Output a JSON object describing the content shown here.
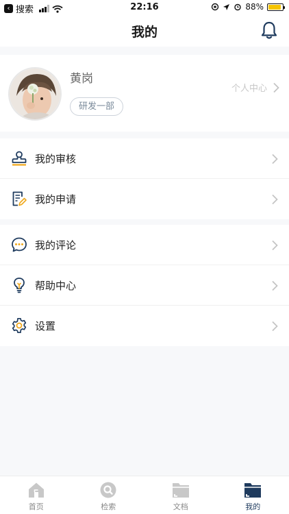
{
  "status_bar": {
    "back_label": "搜索",
    "time": "22:16",
    "battery": "88%",
    "battery_level": 0.88
  },
  "nav": {
    "title": "我的",
    "right_icon": "bell-icon"
  },
  "profile": {
    "name": "黄岗",
    "department": "研发一部",
    "center_link": "个人中心"
  },
  "menu_groups": [
    {
      "items": [
        {
          "label": "我的审核",
          "icon": "stamp-icon"
        },
        {
          "label": "我的申请",
          "icon": "edit-document-icon"
        }
      ]
    },
    {
      "items": [
        {
          "label": "我的评论",
          "icon": "comment-icon"
        },
        {
          "label": "帮助中心",
          "icon": "lightbulb-icon"
        },
        {
          "label": "设置",
          "icon": "gear-icon"
        }
      ]
    }
  ],
  "tabbar": {
    "tabs": [
      {
        "label": "首页",
        "icon": "home-icon",
        "active": false
      },
      {
        "label": "检索",
        "icon": "search-icon",
        "active": false
      },
      {
        "label": "文档",
        "icon": "folder-icon",
        "active": false
      },
      {
        "label": "我的",
        "icon": "profile-folder-icon",
        "active": true
      }
    ]
  },
  "colors": {
    "accent": "#1f3b5e",
    "highlight": "#f0a81c",
    "icon_gray": "#c4c4c4"
  }
}
